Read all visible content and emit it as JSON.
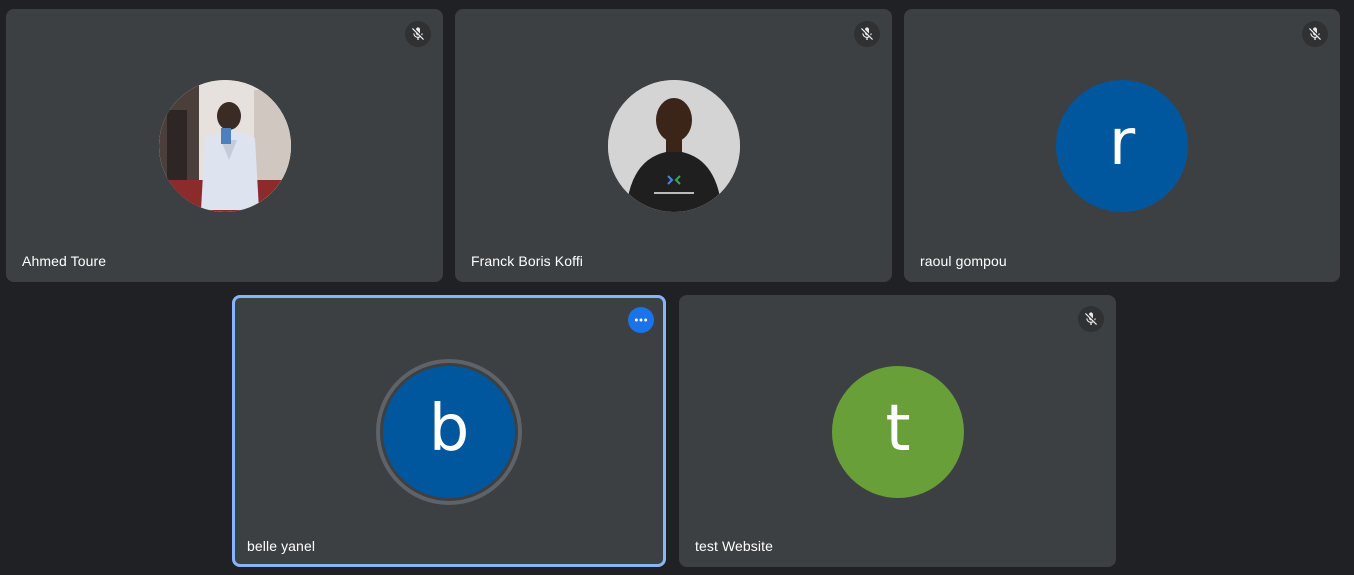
{
  "participants": [
    {
      "name": "Ahmed Toure",
      "avatar_type": "photo",
      "muted": true
    },
    {
      "name": "Franck Boris Koffi",
      "avatar_type": "photo",
      "muted": true
    },
    {
      "name": "raoul gompou",
      "avatar_type": "letter",
      "letter": "r",
      "avatar_color": "#00579d",
      "muted": true
    },
    {
      "name": "belle yanel",
      "avatar_type": "letter",
      "letter": "b",
      "avatar_color": "#00579d",
      "muted": false,
      "active_speaker": true
    },
    {
      "name": "test Website",
      "avatar_type": "letter",
      "letter": "t",
      "avatar_color": "#689f38",
      "muted": true
    }
  ],
  "icons": {
    "mute": "mic-off-icon",
    "more": "more-options-icon"
  },
  "colors": {
    "background": "#202124",
    "tile": "#3c4043",
    "active_border": "#8ab4f8",
    "more_button": "#1a73e8"
  }
}
